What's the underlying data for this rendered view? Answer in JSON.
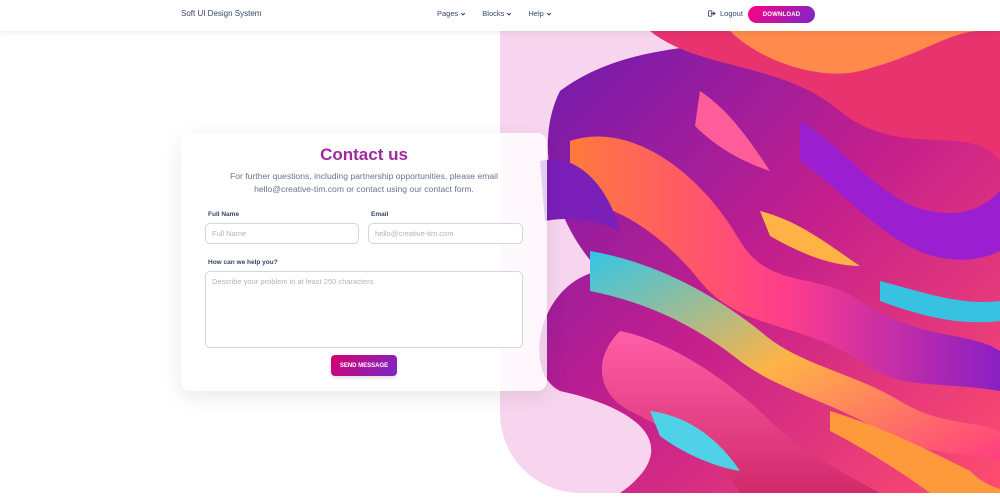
{
  "navbar": {
    "brand": "Soft UI Design System",
    "menu": [
      {
        "label": "Pages",
        "icon": "chevron-down-icon"
      },
      {
        "label": "Blocks",
        "icon": "chevron-down-icon"
      },
      {
        "label": "Help",
        "icon": "chevron-down-icon"
      }
    ],
    "logout_label": "Logout",
    "logout_icon": "sign-out-icon",
    "download_label": "DOWNLOAD"
  },
  "contact": {
    "title": "Contact us",
    "description": "For further questions, including partnership opportunities, please email hello@creative-tim.com or contact using our contact form.",
    "full_name_label": "Full Name",
    "full_name_placeholder": "Full Name",
    "full_name_value": "",
    "email_label": "Email",
    "email_placeholder": "hello@creative-tim.com",
    "email_value": "",
    "message_label": "How can we help you?",
    "message_placeholder": "Describe your problem in at least 250 characters",
    "message_value": "",
    "send_label": "SEND MESSAGE"
  },
  "colors": {
    "title_gradient": [
      "#7928ca",
      "#ff0080"
    ],
    "button_gradient": [
      "#7928ca",
      "#ff0080"
    ],
    "text": "#344767",
    "muted": "#67748e",
    "art_background": "#f8d5ee"
  }
}
